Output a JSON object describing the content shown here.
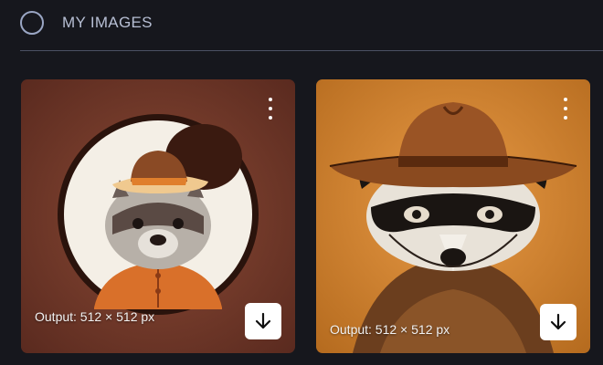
{
  "header": {
    "title": "MY IMAGES",
    "icon": "circle-icon"
  },
  "cards": [
    {
      "caption": "Output: 512 × 512 px",
      "menu_icon": "more-vertical-icon",
      "download_icon": "download-icon",
      "image_subject": "cartoon raccoon in cowboy hat",
      "background": "#7a3d2a"
    },
    {
      "caption": "Output: 512 × 512 px",
      "menu_icon": "more-vertical-icon",
      "download_icon": "download-icon",
      "image_subject": "ink drawing raccoon in cowboy hat",
      "background": "#c87a2a"
    }
  ]
}
